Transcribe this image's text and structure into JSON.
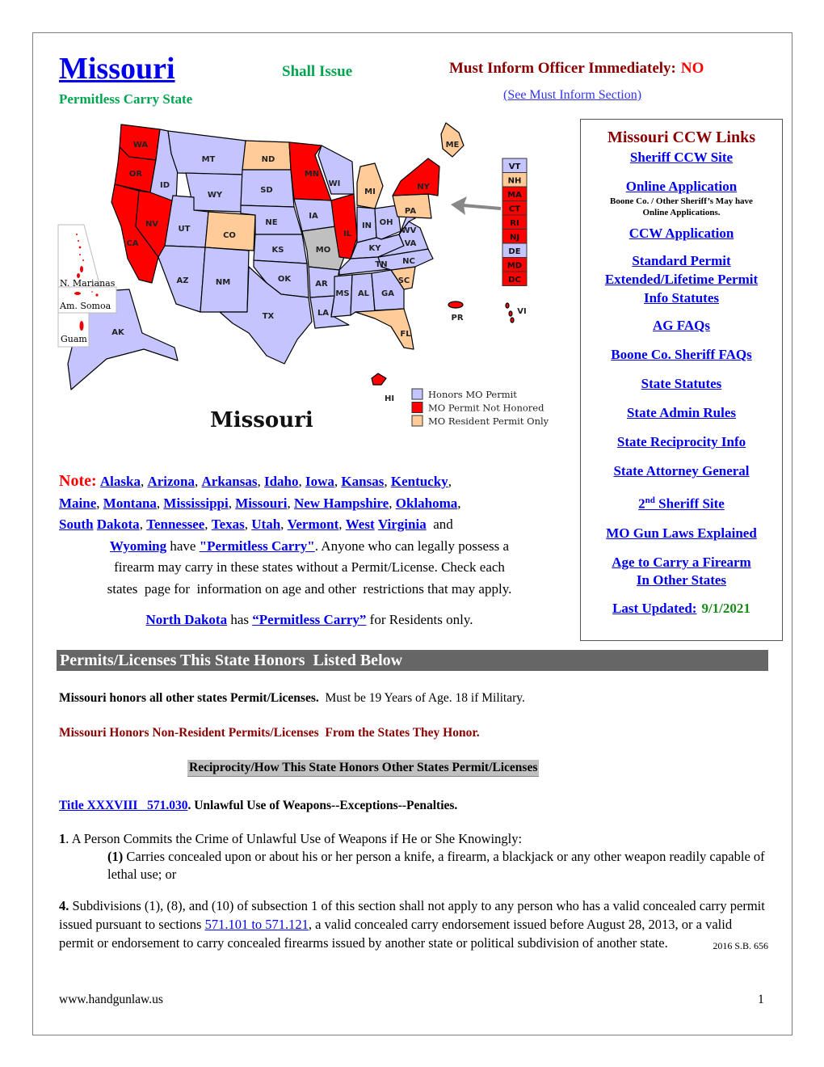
{
  "header": {
    "state_title": "Missouri",
    "issue_type": "Shall Issue",
    "carry_status": "Permitless Carry State",
    "must_inform_label": "Must Inform Officer Immediately:",
    "must_inform_value": "NO",
    "see_must_inform_link": "(See Must Inform Section)"
  },
  "map": {
    "title": "Missouri",
    "colors": {
      "honors": "#c4c4ff",
      "not_honored": "#ff0000",
      "resident_only": "#ffcc99",
      "home_state": "#c0c0c0"
    },
    "legend": [
      {
        "label": "Honors MO Permit",
        "status": "honors"
      },
      {
        "label": "MO Permit Not Honored",
        "status": "not_honored"
      },
      {
        "label": "MO Resident Permit Only",
        "status": "resident_only"
      }
    ],
    "states": {
      "WA": "not_honored",
      "OR": "not_honored",
      "CA": "not_honored",
      "NV": "not_honored",
      "ID": "honors",
      "MT": "honors",
      "WY": "honors",
      "UT": "honors",
      "AZ": "honors",
      "NM": "honors",
      "CO": "resident_only",
      "ND": "resident_only",
      "SD": "honors",
      "NE": "honors",
      "KS": "honors",
      "OK": "honors",
      "TX": "honors",
      "MN": "not_honored",
      "IA": "honors",
      "MO": "home",
      "AR": "honors",
      "LA": "honors",
      "WI": "honors",
      "IL": "not_honored",
      "MI": "resident_only",
      "IN": "honors",
      "OH": "honors",
      "KY": "honors",
      "TN": "honors",
      "MS": "honors",
      "AL": "honors",
      "GA": "honors",
      "FL": "resident_only",
      "SC": "resident_only",
      "NC": "honors",
      "VA": "honors",
      "WV": "honors",
      "PA": "resident_only",
      "NY": "not_honored",
      "ME": "resident_only",
      "AK": "honors",
      "HI": "not_honored",
      "PR": "not_honored",
      "VI": "not_honored"
    },
    "northeast_box": [
      {
        "code": "VT",
        "status": "honors"
      },
      {
        "code": "NH",
        "status": "resident_only"
      },
      {
        "code": "MA",
        "status": "not_honored"
      },
      {
        "code": "CT",
        "status": "not_honored"
      },
      {
        "code": "RI",
        "status": "not_honored"
      },
      {
        "code": "NJ",
        "status": "not_honored"
      },
      {
        "code": "DE",
        "status": "honors"
      },
      {
        "code": "MD",
        "status": "not_honored"
      },
      {
        "code": "DC",
        "status": "not_honored"
      }
    ],
    "territories": [
      "N. Marianas",
      "Am. Somoa",
      "Guam"
    ],
    "other_labels": [
      "HI",
      "PR",
      "VI",
      "AK"
    ]
  },
  "links_box": {
    "title": "Missouri CCW Links",
    "links": {
      "sheriff_ccw_site": "Sheriff CCW Site",
      "online_application": "Online Application",
      "online_application_note_1": "Boone Co. / Other Sheriff’s May have",
      "online_application_note_2": "Online Applications.",
      "ccw_application": "CCW Application",
      "standard_permit": "Standard Permit",
      "extended_lifetime_permit": "Extended/Lifetime Permit",
      "info_statutes": "Info Statutes",
      "ag_faqs": "AG FAQs",
      "boone_sheriff_faqs": "Boone Co. Sheriff FAQs",
      "state_statutes": "State Statutes",
      "state_admin_rules": "State Admin Rules",
      "state_reciprocity_info": "State Reciprocity Info",
      "state_attorney_general": "State Attorney General",
      "second_sheriff_num": "2",
      "second_sheriff_sup": "nd",
      "second_sheriff_rest": " Sheriff Site",
      "mo_gun_laws": "MO Gun Laws Explained",
      "age_to_carry_1": "Age to Carry a Firearm",
      "age_to_carry_2": "In Other States",
      "last_updated_label": "Last Updated:",
      "last_updated_date": "9/1/2021"
    }
  },
  "note": {
    "label": "Note:",
    "states": [
      "Alaska",
      "Arizona",
      "Arkansas",
      "Idaho",
      "Iowa",
      "Kansas",
      "Kentucky",
      "Maine",
      "Montana",
      "Mississippi",
      "Missouri",
      "New Hampshire",
      "Oklahoma",
      "South",
      "Dakota",
      "Tennessee",
      "Texas",
      "Utah",
      "Vermont",
      "West",
      "Virginia",
      "Wyoming"
    ],
    "and": "and",
    "have": "have",
    "permitless_carry_link": "\"Permitless Carry\"",
    "text_after": ". Anyone who can legally possess a",
    "text_line5": "firearm may carry in these states without a Permit/License. Check each",
    "text_line6": "states  page for  information on age and other  restrictions that may apply.",
    "nd_link": "North Dakota",
    "nd_has": "has",
    "nd_permitless_link": "“Permitless Carry”",
    "nd_rest": "for Residents only."
  },
  "section": {
    "header": "Permits/Licenses This State Honors  Listed Below",
    "honors_bold": "Missouri honors all other states Permit/Licenses.",
    "honors_rest": "Must be 19 Years of Age. 18 if Military.",
    "nonresident": "Missouri Honors Non-Resident Permits/Licenses  From the States They Honor.",
    "reciprocity_header": "Reciprocity/How This State Honors Other States Permit/Licenses"
  },
  "statute": {
    "title_link": "Title XXXVIII   571.030",
    "title_text": ".  Unlawful Use of Weapons--Exceptions--Penalties.",
    "p1_num": "1",
    "p1_text": ". A Person Commits the Crime of Unlawful Use of Weapons if He or She Knowingly:",
    "p1_sub_num": "(1)",
    "p1_sub_text": " Carries concealed upon or about his or her person a knife, a firearm, a blackjack or any other weapon readily capable of lethal use; or",
    "p4_num": "4.",
    "p4_text_a": " Subdivisions (1), (8), and (10) of subsection 1 of this section shall not apply to any person who has a valid concealed carry permit issued pursuant to sections ",
    "p4_link": "571.101 to 571.121",
    "p4_text_b": ", a valid concealed carry endorsement issued before August 28, 2013, or a valid permit or endorsement to carry concealed firearms issued by another state or political subdivision of another state.",
    "citation": "2016 S.B. 656"
  },
  "footer": {
    "url": "www.handgunlaw.us",
    "page_number": "1"
  }
}
